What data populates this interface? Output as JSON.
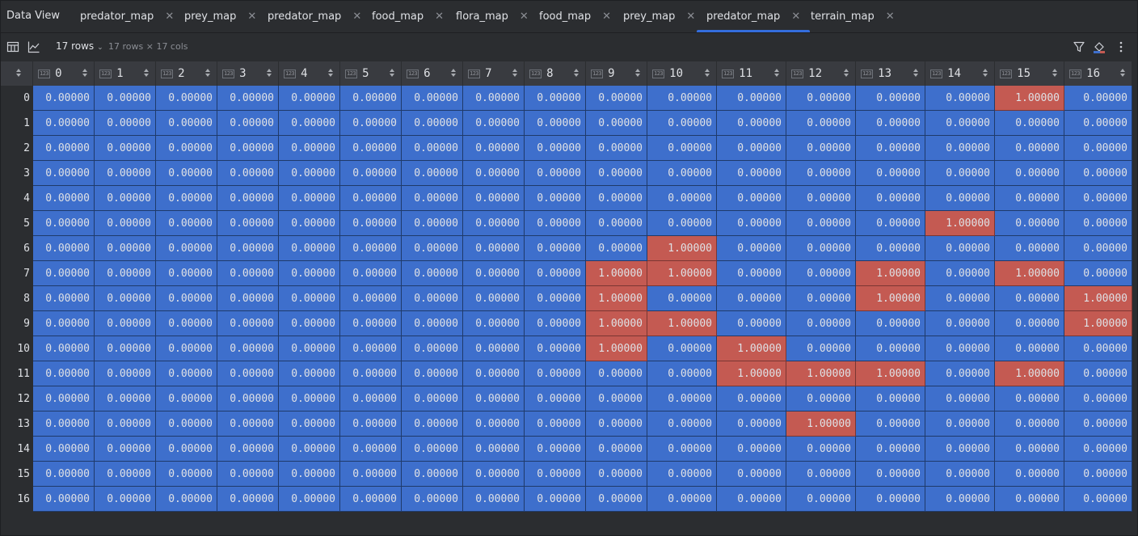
{
  "app": {
    "title": "Data View"
  },
  "tabs": [
    {
      "label": "predator_map",
      "active": false
    },
    {
      "label": "prey_map",
      "active": false
    },
    {
      "label": "predator_map",
      "active": false
    },
    {
      "label": "food_map",
      "active": false
    },
    {
      "label": "flora_map",
      "active": false
    },
    {
      "label": "food_map",
      "active": false
    },
    {
      "label": "prey_map",
      "active": false
    },
    {
      "label": "predator_map",
      "active": true
    },
    {
      "label": "terrain_map",
      "active": false
    }
  ],
  "toolbar": {
    "rows_label": "17 rows",
    "dims_label": "17 rows × 17 cols",
    "icons": [
      "table-view-icon",
      "chart-view-icon",
      "filter-icon",
      "color-fill-icon",
      "more-vertical-icon"
    ]
  },
  "grid": {
    "type_badge": "123",
    "columns": [
      "0",
      "1",
      "2",
      "3",
      "4",
      "5",
      "6",
      "7",
      "8",
      "9",
      "10",
      "11",
      "12",
      "13",
      "14",
      "15",
      "16"
    ],
    "rows": [
      "0",
      "1",
      "2",
      "3",
      "4",
      "5",
      "6",
      "7",
      "8",
      "9",
      "10",
      "11",
      "12",
      "13",
      "14",
      "15",
      "16"
    ],
    "zero_text": "0.00000",
    "one_text": "1.00000",
    "ones": [
      [
        0,
        15
      ],
      [
        5,
        14
      ],
      [
        6,
        10
      ],
      [
        7,
        9
      ],
      [
        7,
        10
      ],
      [
        7,
        13
      ],
      [
        7,
        15
      ],
      [
        8,
        9
      ],
      [
        8,
        13
      ],
      [
        8,
        16
      ],
      [
        9,
        9
      ],
      [
        9,
        10
      ],
      [
        9,
        16
      ],
      [
        10,
        9
      ],
      [
        10,
        11
      ],
      [
        11,
        11
      ],
      [
        11,
        12
      ],
      [
        11,
        13
      ],
      [
        11,
        15
      ],
      [
        13,
        12
      ]
    ],
    "colors": {
      "low": "#3e6fcc",
      "high": "#c45a52"
    }
  }
}
